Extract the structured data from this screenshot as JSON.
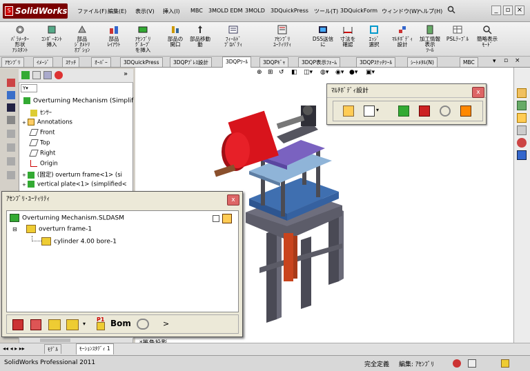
{
  "app": {
    "title": "SolidWorks",
    "logo_mark": "S"
  },
  "menu": [
    "ファイル(F)",
    "編集(E)",
    "表示(V)",
    "挿入(I)",
    "MBC",
    "3MOLD EDM",
    "3MOLD",
    "3DQuickPress",
    "ツール(T)",
    "3DQuickForm",
    "ウィンドウ(W)",
    "ヘルプ(H)"
  ],
  "window_controls": {
    "minimize": "_",
    "restore": "▫",
    "close": "×"
  },
  "commands": [
    "ﾊﾟﾗﾒｰﾀｰ\n形状\nｱｼｽﾀﾝﾄ",
    "ｺﾝﾎﾟｰﾈﾝﾄ\n挿入",
    "部品\nｼﾞｵﾒﾄﾘ\nｵﾌﾟｼｮﾝ",
    "部品\nﾚｲｱｳﾄ",
    "ｱｾﾝﾌﾞﾘ\nｸﾞﾙｰﾌﾟ\nを挿入",
    "部品の\n開口",
    "部品移動\n動",
    "ﾌｨｰﾙﾄﾞ\nﾌﾟﾛﾊﾟﾃｨ",
    "ｱｾﾝﾌﾞﾘ\nﾕｰﾃｨﾘﾃｨ",
    "DSS送信\nに",
    "寸法を\n確認",
    "ｴｯｼﾞ\n選択",
    "ﾏﾙﾁﾎﾞﾃﾞｨ\n設計",
    "加工情報\n表示\nﾂｰﾙ",
    "PSLﾃｰﾌﾞﾙ",
    "簡略表示\nﾓｰﾄﾞ"
  ],
  "tabs": [
    "ｱｾﾝﾌﾞﾘ",
    "ｲﾒｰｼﾞ",
    "ｽｹｯﾁ",
    "ｵｰﾊﾞｰ",
    "3DQuickPress",
    "3DQPﾌﾟﾚｽ設計",
    "3DQPﾂｰﾙ",
    "3DQPｷﾞｬ",
    "3DQP表示ﾌｫｰﾑ",
    "3DQPｽｹｯﾁﾂｰﾙ",
    "ｼｰﾄﾒﾀﾙ(N)",
    "MBC"
  ],
  "active_tab": "3DQPﾂｰﾙ",
  "tree": {
    "root": "Overturning Mechanism (Simplif",
    "items": [
      "ｾﾝｻｰ",
      "Annotations",
      "Front",
      "Top",
      "Right",
      "Origin",
      "(固定) overturn frame<1> (si",
      "vertical plate<1> (simplified<"
    ]
  },
  "multibody": {
    "title": "ﾏﾙﾁﾎﾞﾃﾞｨ設計",
    "close": "x"
  },
  "asm": {
    "title": "ｱｾﾝﾌﾞﾘ･ﾕｰﾃｨﾘﾃｨ",
    "close": "x",
    "root": "Overturning Mechanism.SLDASM",
    "child": "overturn frame-1",
    "grandchild": "cylinder 4.00 bore-1",
    "bom_label": "P1",
    "bom_text": "Bom",
    "more": ">"
  },
  "viewport_label": "*等角投影",
  "bottom_tabs": [
    "ﾓﾃﾞﾙ",
    "ﾓｰｼｮﾝｽﾀﾃﾞｨ 1"
  ],
  "status": {
    "left": "SolidWorks Professional 2011",
    "s1": "完全定義",
    "s2": "編集: ｱｾﾝﾌﾞﾘ"
  },
  "colors": {
    "cylinder": "#d8141c",
    "frame": "#4a4a55",
    "plate_blue": "#3f6fb0",
    "purple": "#7a62c0"
  }
}
